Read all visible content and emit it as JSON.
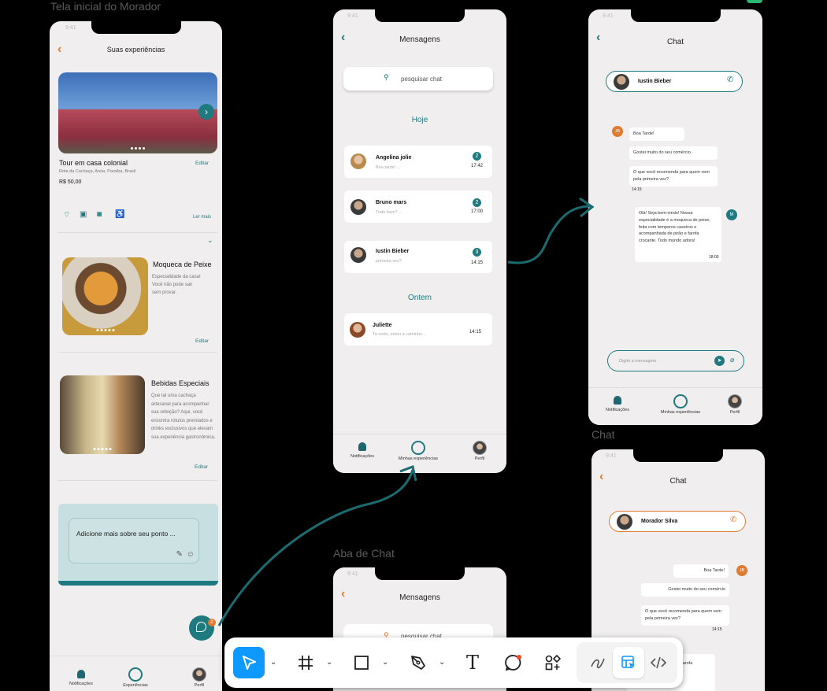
{
  "frames": {
    "home_label": "Tela inicial do Morador",
    "chat_tab_label": "Aba de Chat",
    "chat_label": "Chat"
  },
  "status": {
    "time": "9:41"
  },
  "home": {
    "title": "Suas experiências",
    "tour": {
      "name": "Tour em casa colonial",
      "address": "Rota da Cachaça, Areia, Paraíba, Brasil",
      "price": "R$ 50,00",
      "edit": "Editar",
      "more": "Ler mais"
    },
    "dish1": {
      "name": "Moqueca de Peixe",
      "desc": "Especialidade da casa! Você não pode sair sem provar.",
      "edit": "Editar"
    },
    "dish2": {
      "name": "Bebidas Especiais",
      "desc": "Que tal uma cachaça artesanal para acompanhar sua refeição? Aqui, você encontra rótulos premiados e drinks exclusivos que elevam sua experiência gastronômica.",
      "edit": "Editar"
    },
    "add_more": "Adicione mais sobre seu ponto ...",
    "fab_badge": "2",
    "nav": [
      "Notificações",
      "Experiências",
      "Perfil"
    ]
  },
  "messages": {
    "title": "Mensagens",
    "search_placeholder": "pesquisar chat",
    "today": "Hoje",
    "yesterday": "Ontem",
    "chats": [
      {
        "name": "Angelina jolie",
        "preview": "Boa tarde! ...",
        "time": "17:42",
        "badge": "2"
      },
      {
        "name": "Bruno mars",
        "preview": "Tudo bem? ...",
        "time": "17:00",
        "badge": "2"
      },
      {
        "name": "Iustin Bieber",
        "preview": "primeira vez?",
        "time": "14:15",
        "badge": "3"
      },
      {
        "name": "Juliette",
        "preview": "Ta certo, estou a caminho...",
        "time": "14:15",
        "badge": ""
      }
    ],
    "nav": [
      "Notificações",
      "Minhas experiências",
      "Perfil"
    ]
  },
  "chat1": {
    "title": "Chat",
    "contact": "Iustin Bieber",
    "initials_left": "JB",
    "initials_right": "M",
    "m1": "Boa Tarde!",
    "m2": "Gostei muito do seu comércio",
    "m3": "O que você recomenda para quem vem pela primeira vez?",
    "t1": "14:15",
    "reply": "Olá! Seja bem-vindo! Nossa especialidade é a moqueca de peixe, feita com temperos caseiros e acompanhada de pirão e farofa crocante. Todo mundo adora!",
    "t2": "18:00",
    "input_placeholder": "Digite a mensagem",
    "nav": [
      "Notificações",
      "Minhas experiências",
      "Perfil"
    ]
  },
  "chat2": {
    "title": "Chat",
    "contact": "Morador Silva",
    "initials": "JB",
    "m1": "Boa Tarde!",
    "m2": "Gostei muito do seu comércio",
    "m3": "O que você recomenda para quem vem pela primeira vez?",
    "t1": "14:15",
    "partial": "ssa de peixe, os e pirão e farofa"
  },
  "toolbar": {
    "text_glyph": "T"
  },
  "colors": {
    "teal": "#1f7a80",
    "orange": "#e07a2e",
    "toolbar_active": "#0d99ff"
  }
}
